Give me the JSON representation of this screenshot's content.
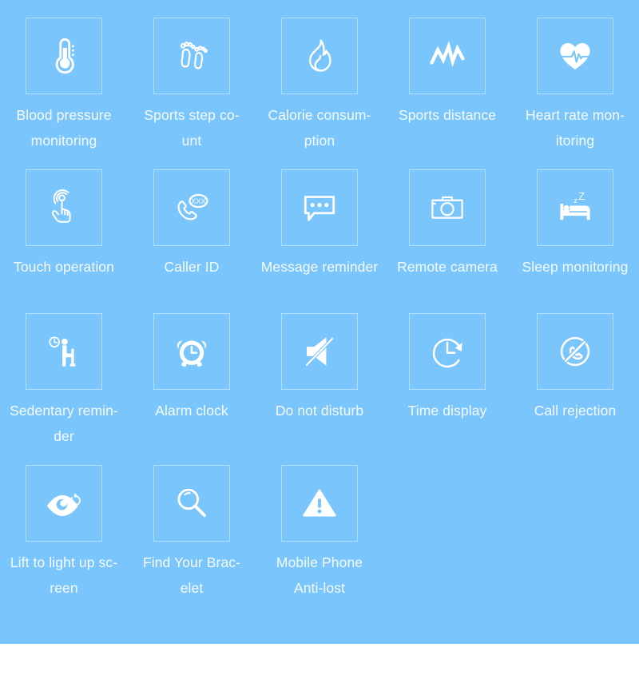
{
  "board": {
    "background_color": "#7ac5fb",
    "icon_color": "#ffffff",
    "label_color": "#ffffff",
    "box_border_color": "rgba(255,255,255,0.45)",
    "bottom_strip_color": "#ffffff"
  },
  "features": [
    {
      "icon": "thermometer-icon",
      "label": "Blood pressure\nmonitoring"
    },
    {
      "icon": "footprints-icon",
      "label": "Sports step co-\nunt"
    },
    {
      "icon": "flame-icon",
      "label": "Calorie consum-\nption"
    },
    {
      "icon": "zigzag-line-icon",
      "label": "Sports distance"
    },
    {
      "icon": "heart-pulse-icon",
      "label": "Heart rate mon-\nitoring"
    },
    {
      "icon": "touch-hand-icon",
      "label": "Touch operation"
    },
    {
      "icon": "caller-id-phone-icon",
      "label": "Caller ID"
    },
    {
      "icon": "chat-bubble-icon",
      "label": "Message reminder"
    },
    {
      "icon": "camera-icon",
      "label": "Remote camera"
    },
    {
      "icon": "sleeping-bed-icon",
      "label": "Sleep monitoring"
    },
    {
      "icon": "sitting-person-clock-icon",
      "label": "Sedentary remin-\nder"
    },
    {
      "icon": "alarm-clock-icon",
      "label": "Alarm clock"
    },
    {
      "icon": "mute-speaker-icon",
      "label": "Do not disturb"
    },
    {
      "icon": "clock-arrow-icon",
      "label": "Time display"
    },
    {
      "icon": "phone-blocked-icon",
      "label": "Call rejection"
    },
    {
      "icon": "eye-refresh-icon",
      "label": "Lift to light up sc-\nreen"
    },
    {
      "icon": "magnifier-icon",
      "label": "Find Your Brac-\nelet"
    },
    {
      "icon": "warning-triangle-icon",
      "label": "Mobile Phone\nAnti-lost"
    }
  ],
  "caller_id": {
    "badge_text": "XXX"
  },
  "sleep": {
    "z_small": "z",
    "z_large": "Z"
  }
}
